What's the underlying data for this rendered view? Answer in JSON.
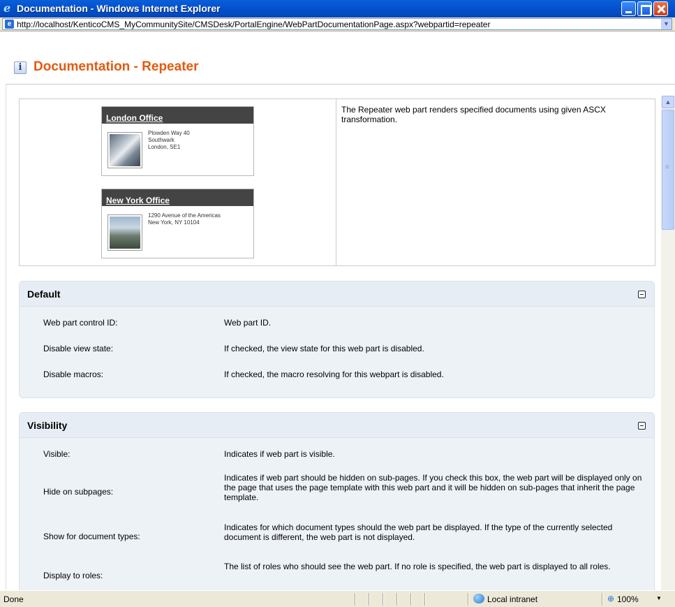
{
  "window": {
    "title": "Documentation - Windows Internet Explorer",
    "address": "http://localhost/KenticoCMS_MyCommunitySite/CMSDesk/PortalEngine/WebPartDocumentationPage.aspx?webpartid=repeater"
  },
  "page": {
    "title": "Documentation  -  Repeater"
  },
  "preview": {
    "offices": [
      {
        "name": "London Office",
        "address": [
          "Plowden Way 40",
          "Southwark",
          "London, SE1"
        ]
      },
      {
        "name": "New York Office",
        "address": [
          "1290 Avenue of the Americas",
          "New York, NY 10104"
        ]
      }
    ],
    "description": "The Repeater web part renders specified documents using given ASCX transformation."
  },
  "sections": [
    {
      "title": "Default",
      "properties": [
        {
          "name": "Web part control ID:",
          "description": "Web part ID."
        },
        {
          "name": "Disable view state:",
          "description": "If checked, the view state for this web part is disabled."
        },
        {
          "name": "Disable macros:",
          "description": "If checked, the macro resolving for this webpart is disabled."
        }
      ]
    },
    {
      "title": "Visibility",
      "properties": [
        {
          "name": "Visible:",
          "description": "Indicates if web part is visible."
        },
        {
          "name": "Hide on subpages:",
          "description": "Indicates if web part should be hidden on sub-pages. If you check this box, the web part will be displayed only on the page that uses the page template with this web part and it will be hidden on sub-pages that inherit the page template."
        },
        {
          "name": "Show for document types:",
          "description": "Indicates for which document types should the web part be displayed. If the type of the currently selected document is different, the web part is not displayed."
        },
        {
          "name": "Display to roles:",
          "description": "The list of roles who should see the web part. If no role is specified, the web part is displayed to all roles."
        }
      ]
    }
  ],
  "status": {
    "text": "Done",
    "zone": "Local intranet",
    "zoom": "100%"
  },
  "icons": {
    "browser": "ie-logo-icon",
    "page": "page-icon",
    "info": "info-icon",
    "collapse": "collapse-icon",
    "zone": "local-intranet-icon",
    "zoom": "zoom-icon"
  }
}
